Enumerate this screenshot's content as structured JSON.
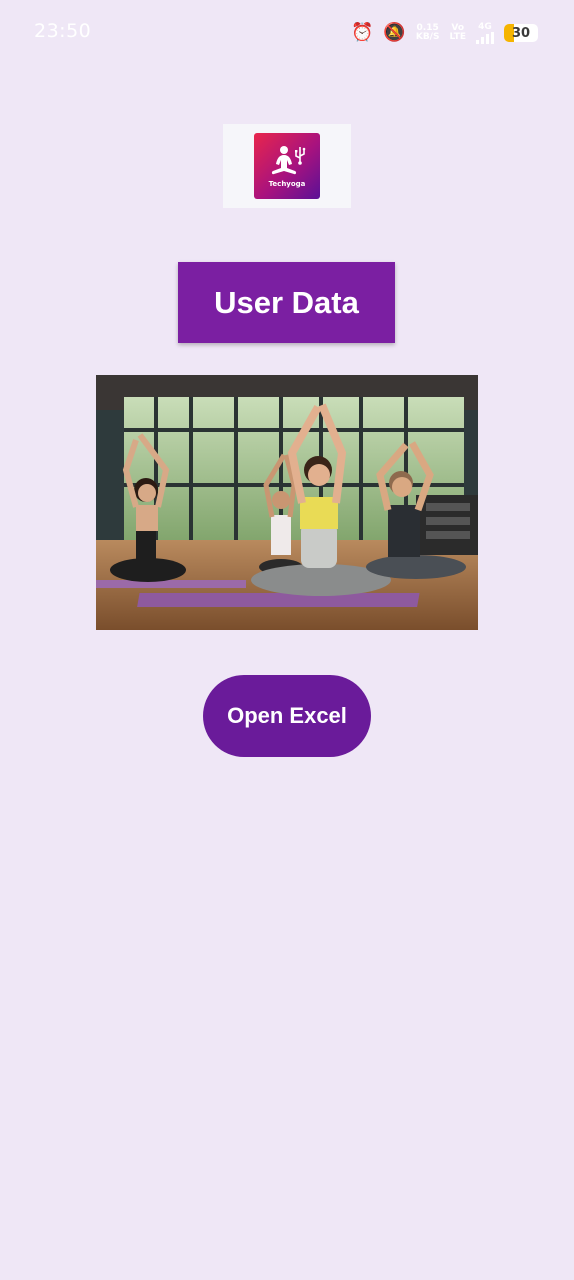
{
  "status_bar": {
    "time": "23:50",
    "data_speed_value": "0.15",
    "data_speed_unit": "KB/S",
    "volte_top": "Vo",
    "volte_bottom": "LTE",
    "network_label": "4G",
    "battery_level": "30",
    "battery_fraction": 0.3,
    "battery_fill_color": "#F5B400",
    "icons": [
      "alarm-icon",
      "bell-muted-icon",
      "data-speed",
      "volte",
      "signal-icon",
      "battery-icon"
    ]
  },
  "logo": {
    "text": "Techyoga",
    "icon": "meditation-usb-icon",
    "gradient": [
      "#E8264C",
      "#A8127E",
      "#5A1196"
    ]
  },
  "title": {
    "text": "User Data",
    "bg_color": "#7B1FA2"
  },
  "hero_image": {
    "description_icon": "yoga-class-photo"
  },
  "open_excel": {
    "label": "Open Excel",
    "bg_color": "#6A1B9A"
  },
  "theme": {
    "background": "#EFE7F6"
  }
}
